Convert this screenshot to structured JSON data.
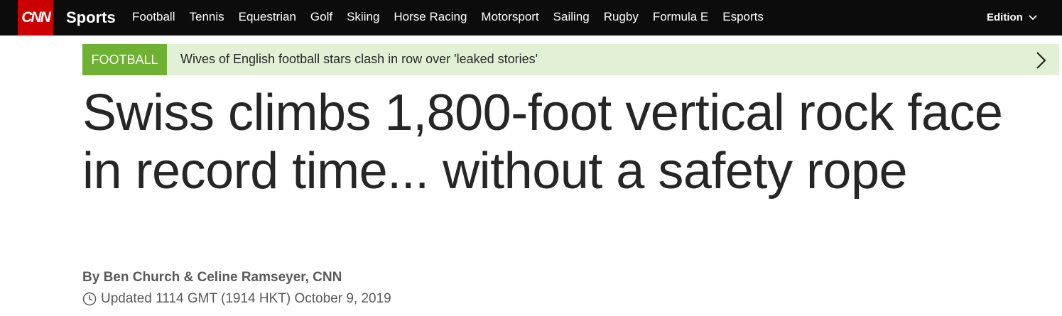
{
  "nav": {
    "logo_text": "CNN",
    "section_title": "Sports",
    "links": [
      "Football",
      "Tennis",
      "Equestrian",
      "Golf",
      "Skiing",
      "Horse Racing",
      "Motorsport",
      "Sailing",
      "Rugby",
      "Formula E",
      "Esports"
    ],
    "edition_label": "Edition",
    "edition_icon": "chevron-down-icon"
  },
  "breaking": {
    "tag": "FOOTBALL",
    "text": "Wives of English football stars clash in row over 'leaked stories'",
    "arrow_icon": "chevron-right-icon"
  },
  "article": {
    "headline": "Swiss climbs 1,800-foot vertical rock face in record time... without a safety rope",
    "byline": "By Ben Church & Celine Ramseyer, CNN",
    "timestamp": "Updated 1114 GMT (1914 HKT) October 9, 2019",
    "clock_icon": "clock-icon"
  },
  "colors": {
    "nav_bg": "#0c0c0c",
    "brand_red": "#cc0000",
    "tag_green": "#6fb132",
    "banner_bg": "#e2f0d5",
    "text_dark": "#262626",
    "text_muted": "#595959"
  }
}
